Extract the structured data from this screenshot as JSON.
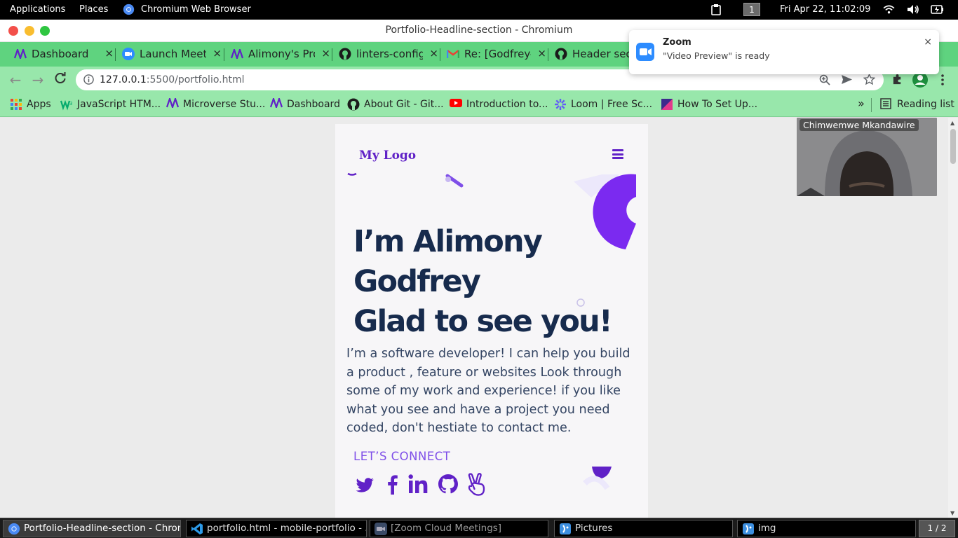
{
  "system_panel": {
    "applications": "Applications",
    "places": "Places",
    "browser_menu": "Chromium Web Browser",
    "workspace": "1",
    "clock": "Fri Apr 22, 11:02:09"
  },
  "window": {
    "title": "Portfolio-Headline-section - Chromium"
  },
  "tabs": [
    {
      "label": "Dashboard",
      "icon": "microverse-icon"
    },
    {
      "label": "Launch Meeting",
      "icon": "zoom-icon"
    },
    {
      "label": "Alimony's Progress",
      "icon": "microverse-icon"
    },
    {
      "label": "linters-config",
      "icon": "github-icon"
    },
    {
      "label": "Re: [Godfrey-",
      "icon": "gmail-icon"
    },
    {
      "label": "Header section",
      "icon": "github-icon"
    }
  ],
  "tab_close": "×",
  "toolbar": {
    "url_host": "127.0.0.1",
    "url_path": ":5500/portfolio.html"
  },
  "bookmarks": {
    "items": [
      {
        "label": "Apps",
        "icon": "apps-grid-icon"
      },
      {
        "label": "JavaScript HTM...",
        "icon": "w3-icon"
      },
      {
        "label": "Microverse Stu...",
        "icon": "microverse-icon"
      },
      {
        "label": "Dashboard",
        "icon": "microverse-icon"
      },
      {
        "label": "About Git - Git...",
        "icon": "github-icon"
      },
      {
        "label": "Introduction to...",
        "icon": "youtube-icon"
      },
      {
        "label": "Loom | Free Sc...",
        "icon": "loom-icon"
      },
      {
        "label": "How To Set Up...",
        "icon": "bookmark-doc-icon"
      }
    ],
    "overflow": "»",
    "reading_list": "Reading list"
  },
  "page": {
    "logo": "My Logo",
    "headline_line1": "I’m Alimony",
    "headline_line2": "Godfrey",
    "headline_line3": "Glad to see you!",
    "intro": "I’m a software developer! I can help you build a product , feature or websites Look through some of my work and experience! if you like what you see and have a project you need coded, don't hestiate to contact me.",
    "connect": "LET’S CONNECT",
    "socials": [
      "twitter-icon",
      "facebook-icon",
      "linkedin-icon",
      "github-icon",
      "angellist-icon"
    ]
  },
  "zoom_video": {
    "participant": "Chimwemwe Mkandawire"
  },
  "notification": {
    "app": "Zoom",
    "message": "\"Video Preview\" is ready",
    "close": "×"
  },
  "taskbar": {
    "items": [
      {
        "label": "Portfolio-Headline-section - Chrom...",
        "icon": "chromium-icon",
        "active": true
      },
      {
        "label": "portfolio.html - mobile-portfolio - ...",
        "icon": "vscode-icon",
        "active": false
      },
      {
        "label": "[Zoom Cloud Meetings]",
        "icon": "zoom-icon",
        "active": false
      },
      {
        "label": "Pictures",
        "icon": "file-manager-icon",
        "active": false
      },
      {
        "label": "img",
        "icon": "file-manager-icon",
        "active": false
      }
    ],
    "pager": "1 / 2"
  },
  "colors": {
    "accent": "#6021c7",
    "headline": "#172b4d",
    "tab_strip": "#5fd37f",
    "toolbar": "#98e7ab"
  }
}
